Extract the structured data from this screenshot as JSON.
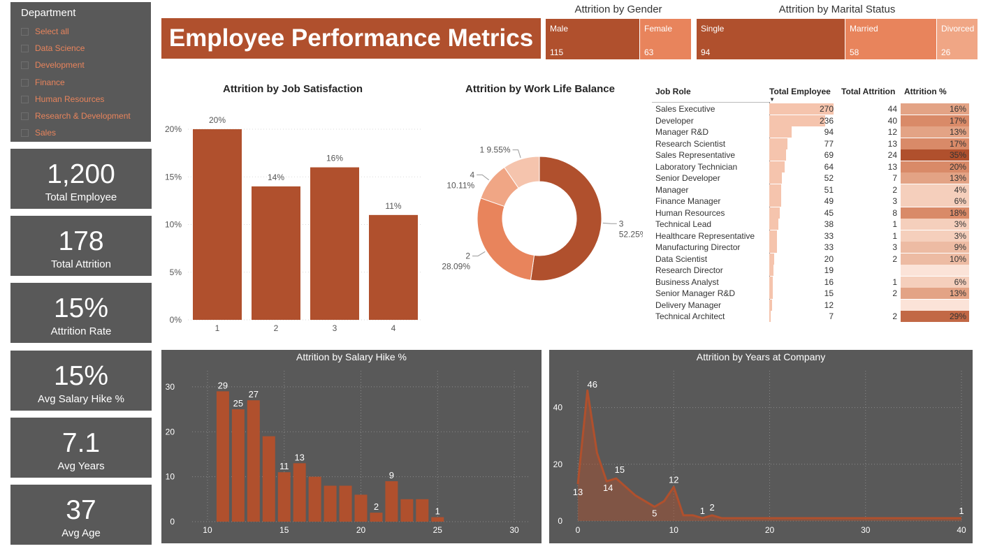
{
  "slicer": {
    "title": "Department",
    "items": [
      {
        "label": "Select all"
      },
      {
        "label": "Data Science"
      },
      {
        "label": "Development"
      },
      {
        "label": "Finance"
      },
      {
        "label": "Human Resources"
      },
      {
        "label": "Research & Development"
      },
      {
        "label": "Sales"
      }
    ]
  },
  "kpis": [
    {
      "value": "1,200",
      "label": "Total Employee"
    },
    {
      "value": "178",
      "label": "Total Attrition"
    },
    {
      "value": "15%",
      "label": "Attrition Rate"
    },
    {
      "value": "15%",
      "label": "Avg Salary Hike %"
    },
    {
      "value": "7.1",
      "label": "Avg Years"
    },
    {
      "value": "37",
      "label": "Avg Age"
    }
  ],
  "title": "Employee Performance Metrics",
  "gender": {
    "title": "Attrition by Gender",
    "tiles": [
      {
        "label": "Male",
        "value": "115"
      },
      {
        "label": "Female",
        "value": "63"
      }
    ]
  },
  "marital": {
    "title": "Attrition by Marital Status",
    "tiles": [
      {
        "label": "Single",
        "value": "94"
      },
      {
        "label": "Married",
        "value": "58"
      },
      {
        "label": "Divorced",
        "value": "26"
      }
    ]
  },
  "job_table": {
    "headers": [
      "Job Role",
      "Total Employee",
      "Total Attrition",
      "Attrition %"
    ],
    "rows": [
      {
        "role": "Sales Executive",
        "employees": "270",
        "attrition": "44",
        "pct": "16%"
      },
      {
        "role": "Developer",
        "employees": "236",
        "attrition": "40",
        "pct": "17%"
      },
      {
        "role": "Manager R&D",
        "employees": "94",
        "attrition": "12",
        "pct": "13%"
      },
      {
        "role": "Research Scientist",
        "employees": "77",
        "attrition": "13",
        "pct": "17%"
      },
      {
        "role": "Sales Representative",
        "employees": "69",
        "attrition": "24",
        "pct": "35%"
      },
      {
        "role": "Laboratory Technician",
        "employees": "64",
        "attrition": "13",
        "pct": "20%"
      },
      {
        "role": "Senior Developer",
        "employees": "52",
        "attrition": "7",
        "pct": "13%"
      },
      {
        "role": "Manager",
        "employees": "51",
        "attrition": "2",
        "pct": "4%"
      },
      {
        "role": "Finance Manager",
        "employees": "49",
        "attrition": "3",
        "pct": "6%"
      },
      {
        "role": "Human Resources",
        "employees": "45",
        "attrition": "8",
        "pct": "18%"
      },
      {
        "role": "Technical Lead",
        "employees": "38",
        "attrition": "1",
        "pct": "3%"
      },
      {
        "role": "Healthcare Representative",
        "employees": "33",
        "attrition": "1",
        "pct": "3%"
      },
      {
        "role": "Manufacturing Director",
        "employees": "33",
        "attrition": "3",
        "pct": "9%"
      },
      {
        "role": "Data Scientist",
        "employees": "20",
        "attrition": "2",
        "pct": "10%"
      },
      {
        "role": "Research Director",
        "employees": "19",
        "attrition": "",
        "pct": ""
      },
      {
        "role": "Business Analyst",
        "employees": "16",
        "attrition": "1",
        "pct": "6%"
      },
      {
        "role": "Senior Manager R&D",
        "employees": "15",
        "attrition": "2",
        "pct": "13%"
      },
      {
        "role": "Delivery Manager",
        "employees": "12",
        "attrition": "",
        "pct": ""
      },
      {
        "role": "Technical Architect",
        "employees": "7",
        "attrition": "2",
        "pct": "29%"
      }
    ]
  },
  "colors": {
    "accent": "#b0502d",
    "accent_light": "#e8845c",
    "panel": "#595959"
  },
  "chart_data": [
    {
      "type": "bar",
      "title": "Attrition by Job Satisfaction",
      "categories": [
        "1",
        "2",
        "3",
        "4"
      ],
      "values": [
        20,
        14,
        16,
        11
      ],
      "data_labels": [
        "20%",
        "14%",
        "16%",
        "11%"
      ],
      "yticks": [
        "0%",
        "5%",
        "10%",
        "15%",
        "20%"
      ],
      "ylim": [
        0,
        20
      ]
    },
    {
      "type": "pie",
      "title": "Attrition by Work Life Balance",
      "slices": [
        {
          "label": "3",
          "value": 52.25,
          "text": "52.25%"
        },
        {
          "label": "2",
          "value": 28.09,
          "text": "28.09%"
        },
        {
          "label": "4",
          "value": 10.11,
          "text": "10.11%"
        },
        {
          "label": "1",
          "value": 9.55,
          "text": "9.55%"
        }
      ]
    },
    {
      "type": "bar",
      "title": "Attrition by Salary Hike %",
      "x": [
        11,
        12,
        13,
        14,
        15,
        16,
        17,
        18,
        19,
        20,
        21,
        22,
        23,
        24,
        25
      ],
      "values": [
        29,
        25,
        27,
        19,
        11,
        13,
        10,
        8,
        8,
        6,
        2,
        9,
        5,
        5,
        1
      ],
      "labeled_x": [
        11,
        12,
        13,
        15,
        16,
        21,
        22,
        25
      ],
      "xticks": [
        "10",
        "15",
        "20",
        "25",
        "30"
      ],
      "yticks": [
        "0",
        "10",
        "20",
        "30"
      ],
      "xlim": [
        9,
        31
      ],
      "ylim": [
        0,
        32
      ]
    },
    {
      "type": "area",
      "title": "Attrition by Years at Company",
      "x": [
        0,
        1,
        2,
        3,
        4,
        5,
        6,
        7,
        8,
        9,
        10,
        11,
        12,
        13,
        14,
        15,
        16,
        17,
        18,
        19,
        20,
        21,
        22,
        23,
        24,
        25,
        26,
        27,
        28,
        29,
        30,
        31,
        32,
        33,
        34,
        35,
        36,
        37,
        38,
        39,
        40
      ],
      "values": [
        13,
        46,
        24,
        14,
        15,
        12,
        9,
        7,
        5,
        7,
        12,
        2,
        2,
        1,
        2,
        1,
        1,
        1,
        1,
        1,
        1,
        1,
        1,
        1,
        1,
        1,
        1,
        1,
        1,
        1,
        1,
        1,
        1,
        1,
        1,
        1,
        1,
        1,
        1,
        1,
        1
      ],
      "point_labels": [
        {
          "x": 0,
          "text": "13"
        },
        {
          "x": 1,
          "text": "46"
        },
        {
          "x": 3,
          "text": "14"
        },
        {
          "x": 4,
          "text": "15"
        },
        {
          "x": 8,
          "text": "5"
        },
        {
          "x": 10,
          "text": "12"
        },
        {
          "x": 13,
          "text": "1"
        },
        {
          "x": 14,
          "text": "2"
        },
        {
          "x": 40,
          "text": "1"
        }
      ],
      "xticks": [
        "0",
        "10",
        "20",
        "30",
        "40"
      ],
      "yticks": [
        "0",
        "20",
        "40"
      ],
      "xlim": [
        0,
        40
      ],
      "ylim": [
        0,
        50
      ]
    }
  ]
}
